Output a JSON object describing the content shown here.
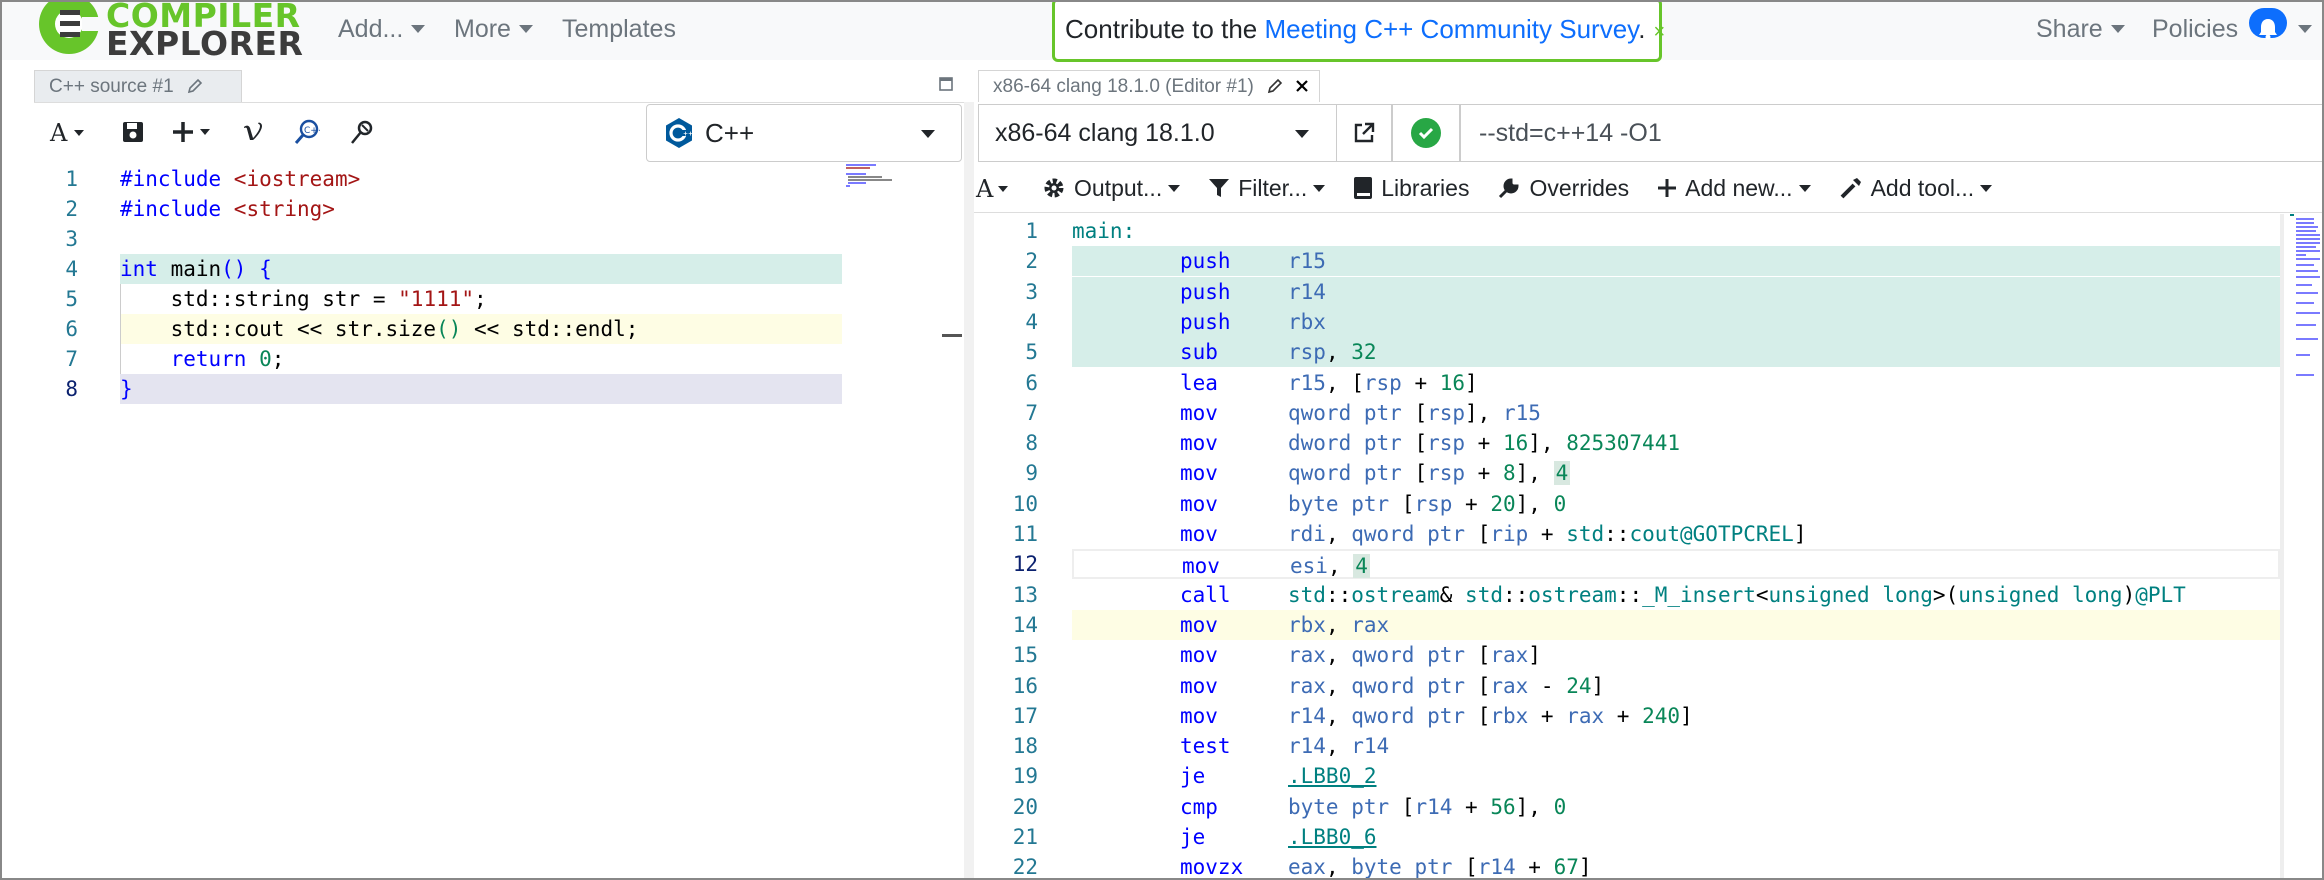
{
  "app": {
    "logo_line1": "COMPILER",
    "logo_line2": "EXPLORER"
  },
  "nav": {
    "add": "Add...",
    "more": "More",
    "templates": "Templates",
    "share": "Share",
    "policies": "Policies"
  },
  "survey": {
    "prefix": "Contribute to the ",
    "link": "Meeting C++ Community Survey",
    "suffix": ".",
    "close": "×"
  },
  "source_pane": {
    "tab_title": "C++ source #1",
    "language": "C++",
    "lines": [
      {
        "n": "1",
        "hl": ""
      },
      {
        "n": "2",
        "hl": ""
      },
      {
        "n": "3",
        "hl": ""
      },
      {
        "n": "4",
        "hl": "green"
      },
      {
        "n": "5",
        "hl": ""
      },
      {
        "n": "6",
        "hl": "yellow"
      },
      {
        "n": "7",
        "hl": ""
      },
      {
        "n": "8",
        "hl": "purple"
      }
    ],
    "code": {
      "l1a": "#include ",
      "l1b": "<iostream>",
      "l2a": "#include ",
      "l2b": "<string>",
      "l4a": "int",
      "l4b": " main",
      "l4c": "() {",
      "l5a": "    std::string str = ",
      "l5b": "\"1111\"",
      "l5c": ";",
      "l6a": "    std::cout << str.size",
      "l6b": "()",
      "l6c": " << std::endl;",
      "l7a": "    return ",
      "l7b": "0",
      "l7c": ";",
      "l8a": "}"
    }
  },
  "compiler_pane": {
    "tab_title": "x86-64 clang 18.1.0 (Editor #1)",
    "compiler": "x86-64 clang 18.1.0",
    "options": "--std=c++14 -O1",
    "toolbar": {
      "output": "Output...",
      "filter": "Filter...",
      "libraries": "Libraries",
      "overrides": "Overrides",
      "add_new": "Add new...",
      "add_tool": "Add tool..."
    },
    "asm": [
      {
        "n": "1",
        "hl": "",
        "label": "main:"
      },
      {
        "n": "2",
        "hl": "green",
        "ins": "push",
        "ops": [
          [
            "reg",
            "r15"
          ]
        ]
      },
      {
        "n": "3",
        "hl": "green",
        "ins": "push",
        "ops": [
          [
            "reg",
            "r14"
          ]
        ]
      },
      {
        "n": "4",
        "hl": "green",
        "ins": "push",
        "ops": [
          [
            "reg",
            "rbx"
          ]
        ]
      },
      {
        "n": "5",
        "hl": "green",
        "ins": "sub",
        "ops": [
          [
            "reg",
            "rsp"
          ],
          [
            "plain",
            ", "
          ],
          [
            "num",
            "32"
          ]
        ]
      },
      {
        "n": "6",
        "hl": "",
        "ins": "lea",
        "ops": [
          [
            "reg",
            "r15"
          ],
          [
            "plain",
            ", ["
          ],
          [
            "reg",
            "rsp"
          ],
          [
            "plain",
            " + "
          ],
          [
            "num",
            "16"
          ],
          [
            "plain",
            "]"
          ]
        ]
      },
      {
        "n": "7",
        "hl": "",
        "ins": "mov",
        "ops": [
          [
            "reg",
            "qword ptr"
          ],
          [
            "plain",
            " ["
          ],
          [
            "reg",
            "rsp"
          ],
          [
            "plain",
            "], "
          ],
          [
            "reg",
            "r15"
          ]
        ]
      },
      {
        "n": "8",
        "hl": "",
        "ins": "mov",
        "ops": [
          [
            "reg",
            "dword ptr"
          ],
          [
            "plain",
            " ["
          ],
          [
            "reg",
            "rsp"
          ],
          [
            "plain",
            " + "
          ],
          [
            "num",
            "16"
          ],
          [
            "plain",
            "], "
          ],
          [
            "num",
            "825307441"
          ]
        ]
      },
      {
        "n": "9",
        "hl": "",
        "ins": "mov",
        "ops": [
          [
            "reg",
            "qword ptr"
          ],
          [
            "plain",
            " ["
          ],
          [
            "reg",
            "rsp"
          ],
          [
            "plain",
            " + "
          ],
          [
            "num",
            "8"
          ],
          [
            "plain",
            "], "
          ],
          [
            "numhl",
            "4"
          ]
        ]
      },
      {
        "n": "10",
        "hl": "",
        "ins": "mov",
        "ops": [
          [
            "reg",
            "byte ptr"
          ],
          [
            "plain",
            " ["
          ],
          [
            "reg",
            "rsp"
          ],
          [
            "plain",
            " + "
          ],
          [
            "num",
            "20"
          ],
          [
            "plain",
            "], "
          ],
          [
            "num",
            "0"
          ]
        ]
      },
      {
        "n": "11",
        "hl": "",
        "ins": "mov",
        "ops": [
          [
            "reg",
            "rdi"
          ],
          [
            "plain",
            ", "
          ],
          [
            "reg",
            "qword ptr"
          ],
          [
            "plain",
            " ["
          ],
          [
            "reg",
            "rip"
          ],
          [
            "plain",
            " + "
          ],
          [
            "lbl",
            "std"
          ],
          [
            "plain",
            "::"
          ],
          [
            "lbl",
            "cout@GOTPCREL"
          ],
          [
            "plain",
            "]"
          ]
        ]
      },
      {
        "n": "12",
        "hl": "box",
        "ins": "mov",
        "ops": [
          [
            "reg",
            "esi"
          ],
          [
            "plain",
            ", "
          ],
          [
            "numhl",
            "4"
          ]
        ]
      },
      {
        "n": "13",
        "hl": "",
        "ins": "call",
        "ops": [
          [
            "lbl",
            "std"
          ],
          [
            "plain",
            "::"
          ],
          [
            "lbl",
            "ostream"
          ],
          [
            "plain",
            "& "
          ],
          [
            "lbl",
            "std"
          ],
          [
            "plain",
            "::"
          ],
          [
            "lbl",
            "ostream"
          ],
          [
            "plain",
            "::"
          ],
          [
            "lbl",
            "_M_insert"
          ],
          [
            "plain",
            "<"
          ],
          [
            "lbl",
            "unsigned long"
          ],
          [
            "plain",
            ">("
          ],
          [
            "lbl",
            "unsigned long"
          ],
          [
            "plain",
            ")"
          ],
          [
            "lbl",
            "@PLT"
          ]
        ]
      },
      {
        "n": "14",
        "hl": "yellow",
        "ins": "mov",
        "ops": [
          [
            "reg",
            "rbx"
          ],
          [
            "plain",
            ", "
          ],
          [
            "reg",
            "rax"
          ]
        ]
      },
      {
        "n": "15",
        "hl": "",
        "ins": "mov",
        "ops": [
          [
            "reg",
            "rax"
          ],
          [
            "plain",
            ", "
          ],
          [
            "reg",
            "qword ptr"
          ],
          [
            "plain",
            " ["
          ],
          [
            "reg",
            "rax"
          ],
          [
            "plain",
            "]"
          ]
        ]
      },
      {
        "n": "16",
        "hl": "",
        "ins": "mov",
        "ops": [
          [
            "reg",
            "rax"
          ],
          [
            "plain",
            ", "
          ],
          [
            "reg",
            "qword ptr"
          ],
          [
            "plain",
            " ["
          ],
          [
            "reg",
            "rax"
          ],
          [
            "plain",
            " - "
          ],
          [
            "num",
            "24"
          ],
          [
            "plain",
            "]"
          ]
        ]
      },
      {
        "n": "17",
        "hl": "",
        "ins": "mov",
        "ops": [
          [
            "reg",
            "r14"
          ],
          [
            "plain",
            ", "
          ],
          [
            "reg",
            "qword ptr"
          ],
          [
            "plain",
            " ["
          ],
          [
            "reg",
            "rbx"
          ],
          [
            "plain",
            " + "
          ],
          [
            "reg",
            "rax"
          ],
          [
            "plain",
            " + "
          ],
          [
            "num",
            "240"
          ],
          [
            "plain",
            "]"
          ]
        ]
      },
      {
        "n": "18",
        "hl": "",
        "ins": "test",
        "ops": [
          [
            "reg",
            "r14"
          ],
          [
            "plain",
            ", "
          ],
          [
            "reg",
            "r14"
          ]
        ]
      },
      {
        "n": "19",
        "hl": "",
        "ins": "je",
        "ops": [
          [
            "link",
            ".LBB0_2"
          ]
        ]
      },
      {
        "n": "20",
        "hl": "",
        "ins": "cmp",
        "ops": [
          [
            "reg",
            "byte ptr"
          ],
          [
            "plain",
            " ["
          ],
          [
            "reg",
            "r14"
          ],
          [
            "plain",
            " + "
          ],
          [
            "num",
            "56"
          ],
          [
            "plain",
            "], "
          ],
          [
            "num",
            "0"
          ]
        ]
      },
      {
        "n": "21",
        "hl": "",
        "ins": "je",
        "ops": [
          [
            "link",
            ".LBB0_6"
          ]
        ]
      },
      {
        "n": "22",
        "hl": "",
        "ins": "movzx",
        "ops": [
          [
            "reg",
            "eax"
          ],
          [
            "plain",
            ", "
          ],
          [
            "reg",
            "byte ptr"
          ],
          [
            "plain",
            " ["
          ],
          [
            "reg",
            "r14"
          ],
          [
            "plain",
            " + "
          ],
          [
            "num",
            "67"
          ],
          [
            "plain",
            "]"
          ]
        ]
      }
    ]
  },
  "colors": {
    "brand_green": "#67c52a",
    "link_blue": "#0d6efd",
    "ok_green": "#28a745"
  }
}
